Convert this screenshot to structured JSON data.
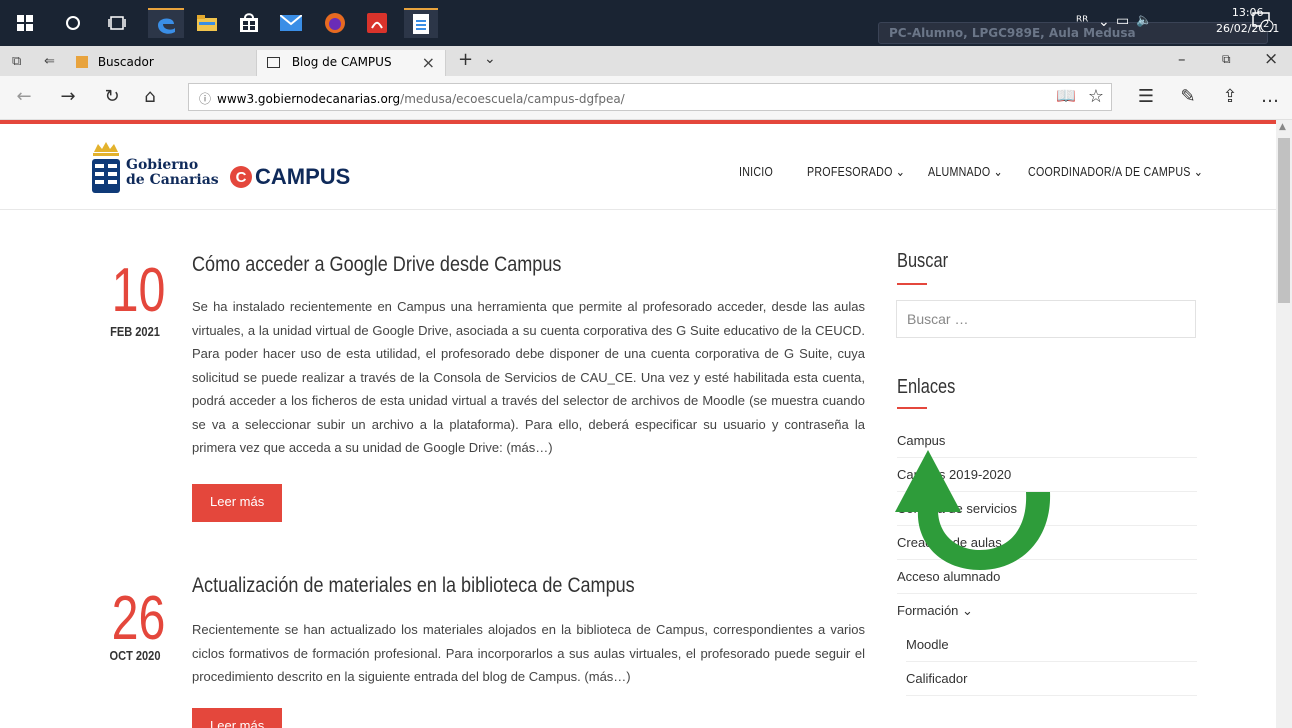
{
  "taskbar": {
    "user_label": "PC-Alumno, LPGC989E, Aula Medusa",
    "time": "13:06",
    "date": "26/02/2021",
    "notification_count": "2"
  },
  "tabs": [
    {
      "label": "Buscador"
    },
    {
      "label": "Blog de CAMPUS"
    }
  ],
  "address": {
    "host": "www3.gobiernodecanarias.org",
    "path": "/medusa/ecoescuela/campus-dgfpea/"
  },
  "site": {
    "gob_line1": "Gobierno",
    "gob_line2": "de Canarias",
    "campus_name": "CAMPUS"
  },
  "menu": [
    {
      "label": "INICIO"
    },
    {
      "label": "PROFESORADO ⌄"
    },
    {
      "label": "ALUMNADO ⌄"
    },
    {
      "label": "COORDINADOR/A DE CAMPUS ⌄"
    }
  ],
  "posts": [
    {
      "day": "10",
      "month": "FEB 2021",
      "title": "Cómo acceder a Google Drive desde Campus",
      "body": "Se ha instalado recientemente en Campus una herramienta que permite al profesorado acceder, desde las aulas virtuales, a la unidad virtual de Google Drive, asociada a su cuenta corporativa des G Suite educativo de la CEUCD. Para poder hacer uso de esta utilidad, el profesorado debe disponer de una cuenta corporativa de G Suite, cuya solicitud se puede realizar a través de la Consola de Servicios de CAU_CE. Una vez y esté habilitada esta cuenta, podrá acceder a los ficheros de esta unidad virtual a través del selector de archivos de Moodle (se muestra cuando se va a seleccionar subir un archivo a la plataforma). Para ello, deberá especificar su usuario y contraseña la primera vez que acceda a su unidad de Google Drive: (más…)",
      "button": "Leer más"
    },
    {
      "day": "26",
      "month": "OCT 2020",
      "title": "Actualización de materiales en la biblioteca de Campus",
      "body": "Recientemente se han actualizado los materiales alojados en la biblioteca de Campus, correspondientes a varios ciclos formativos de formación profesional. Para incorporarlos a sus aulas virtuales, el profesorado puede seguir el procedimiento descrito en la siguiente entrada del blog de Campus. (más…)",
      "button": "Leer más"
    }
  ],
  "sidebar": {
    "search_title": "Buscar",
    "search_placeholder": "Buscar …",
    "links_title": "Enlaces",
    "links": [
      {
        "label": "Campus"
      },
      {
        "label": "Campus 2019-2020"
      },
      {
        "label": "Consola de servicios"
      },
      {
        "label": "Creación de aulas"
      },
      {
        "label": "Acceso alumnado"
      },
      {
        "label": "Formación ⌄"
      }
    ],
    "sublinks": [
      {
        "label": "Moodle"
      },
      {
        "label": "Calificador"
      }
    ]
  },
  "colors": {
    "accent": "#e4473c",
    "arrow": "#2e9c3a"
  }
}
